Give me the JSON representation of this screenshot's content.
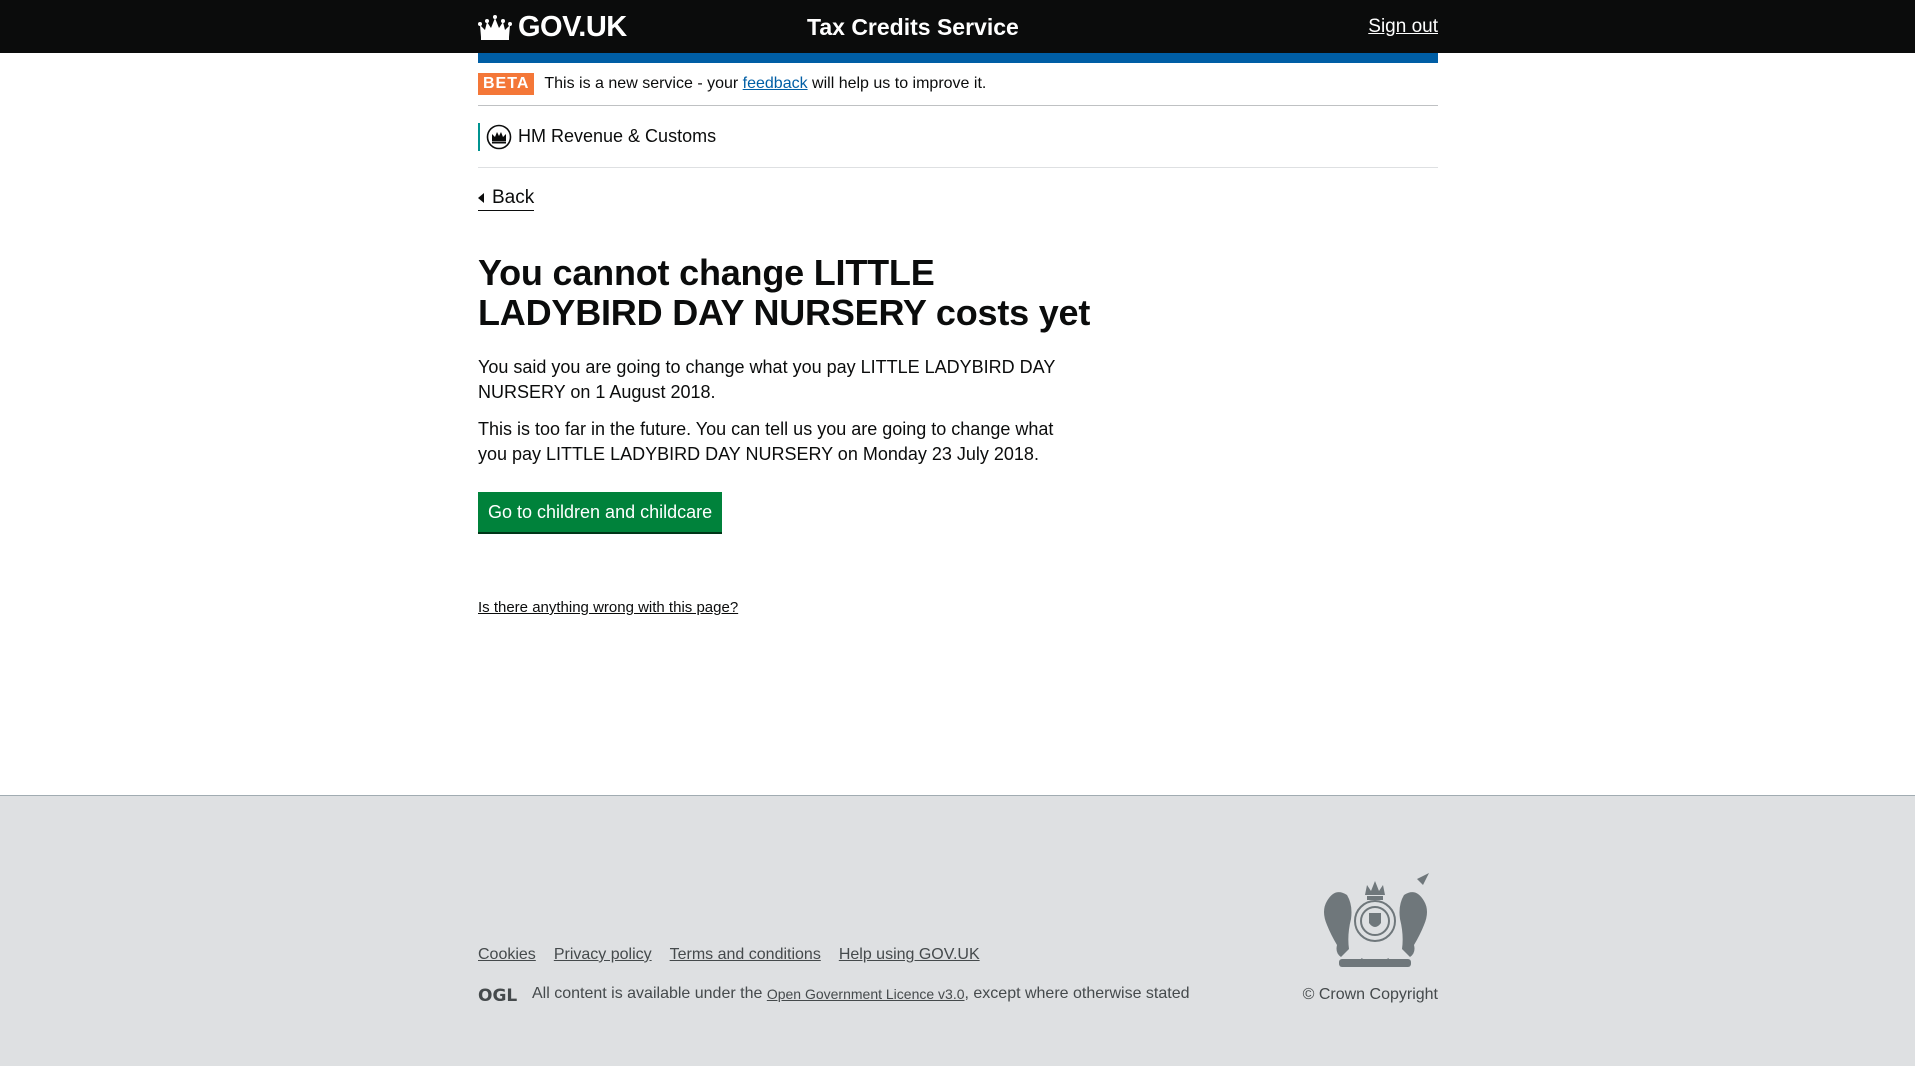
{
  "header": {
    "logo_text": "GOV.UK",
    "service_name": "Tax Credits Service",
    "sign_out": "Sign out"
  },
  "phase_banner": {
    "tag": "BETA",
    "text_before": "This is a new service - your ",
    "link": "feedback",
    "text_after": " will help us to improve it."
  },
  "org": {
    "name": "HM Revenue & Customs"
  },
  "back": {
    "label": "Back"
  },
  "main": {
    "title": "You cannot change LITTLE LADYBIRD DAY NURSERY costs yet",
    "paragraph1": "You said you are going to change what you pay LITTLE LADYBIRD DAY NURSERY on 1 August 2018.",
    "paragraph2": "This is too far in the future. You can tell us you are going to change what you pay LITTLE LADYBIRD DAY NURSERY on Monday 23 July 2018.",
    "button": "Go to children and childcare",
    "report_link": "Is there anything wrong with this page?"
  },
  "footer": {
    "links": [
      "Cookies",
      "Privacy policy",
      "Terms and conditions",
      "Help using GOV.UK"
    ],
    "licence_before": "All content is available under the ",
    "licence_link": "Open Government Licence v3.0",
    "licence_after": ", except where otherwise stated",
    "copyright": "© Crown Copyright",
    "ogl_text": "OGL"
  },
  "colors": {
    "header_bg": "#0b0c0c",
    "blue_bar": "#005ea5",
    "beta_tag": "#f47738",
    "button_green": "#00823b",
    "footer_bg": "#dee0e2",
    "hmrc_line": "#009390"
  },
  "icons": {
    "crown": "crown-icon",
    "hmrc_crest": "hmrc-crest-icon",
    "back_arrow": "triangle-left-icon",
    "royal_arms": "royal-coat-of-arms-icon",
    "ogl": "ogl-logo-icon"
  }
}
